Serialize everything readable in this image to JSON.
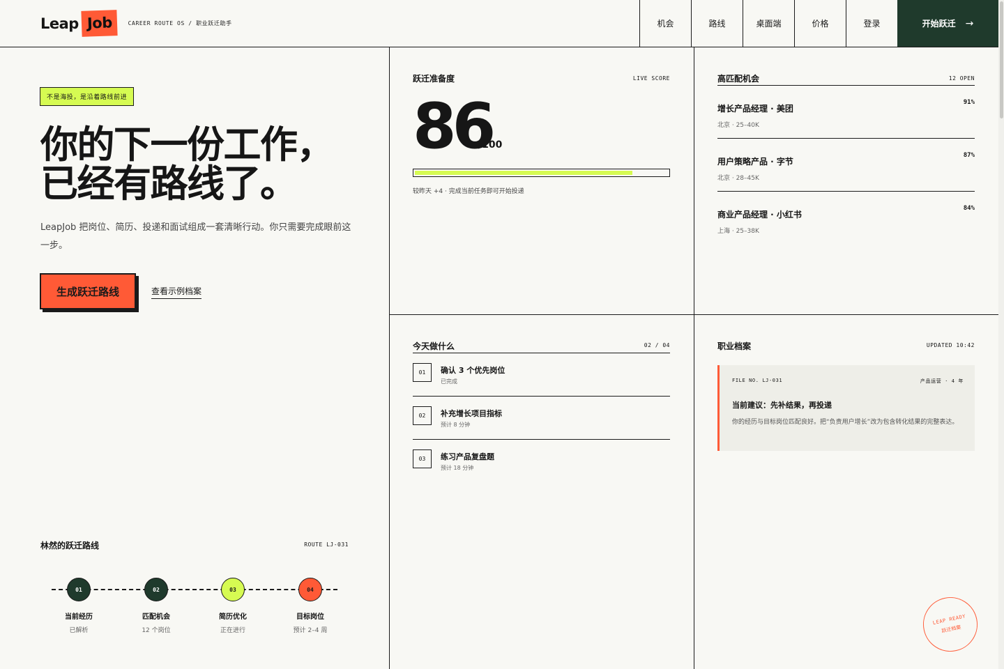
{
  "brand": {
    "logo_part1": "Leap",
    "logo_part2": "Job",
    "tagline": "CAREER ROUTE OS / 职业跃迁助手"
  },
  "nav": {
    "items": [
      "机会",
      "路线",
      "桌面端",
      "价格",
      "登录"
    ],
    "cta_label": "开始跃迁",
    "cta_arrow": "→"
  },
  "hero": {
    "badge": "不是海投，是沿着路线前进",
    "title_line1": "你的下一份工作，",
    "title_line2": "已经有路线了。",
    "description": "LeapJob 把岗位、简历、投递和面试组成一套清晰行动。你只需要完成眼前这一步。",
    "primary_button": "生成跃迁路线",
    "secondary_link": "查看示例档案"
  },
  "route": {
    "title": "林然的跃迁路线",
    "code": "ROUTE LJ-031",
    "steps": [
      {
        "num": "01",
        "name": "当前经历",
        "sub": "已解析"
      },
      {
        "num": "02",
        "name": "匹配机会",
        "sub": "12 个岗位"
      },
      {
        "num": "03",
        "name": "简历优化",
        "sub": "正在进行"
      },
      {
        "num": "04",
        "name": "目标岗位",
        "sub": "预计 2–4 周"
      }
    ]
  },
  "score": {
    "title": "跃迁准备度",
    "meta": "LIVE SCORE",
    "value": "86",
    "max": "/100",
    "progress": 0.86,
    "note": "较昨天 +4 · 完成当前任务即可开始投递"
  },
  "jobs": {
    "title": "高匹配机会",
    "meta": "12 OPEN",
    "items": [
      {
        "title": "增长产品经理 · 美团",
        "sub": "北京 · 25–40K",
        "match": "91%"
      },
      {
        "title": "用户策略产品 · 字节",
        "sub": "北京 · 28–45K",
        "match": "87%"
      },
      {
        "title": "商业产品经理 · 小红书",
        "sub": "上海 · 25–38K",
        "match": "84%"
      }
    ]
  },
  "tasks": {
    "title": "今天做什么",
    "meta": "02 / 04",
    "items": [
      {
        "num": "01",
        "title": "确认 3 个优先岗位",
        "sub": "已完成"
      },
      {
        "num": "02",
        "title": "补充增长项目指标",
        "sub": "预计 8 分钟"
      },
      {
        "num": "03",
        "title": "练习产品复盘题",
        "sub": "预计 18 分钟"
      }
    ]
  },
  "file": {
    "title": "职业档案",
    "meta": "UPDATED 10:42",
    "file_no": "FILE NO. LJ-031",
    "tag": "产品运营 · 4 年",
    "headline": "当前建议：先补结果，再投递",
    "body": "你的经历与目标岗位匹配良好。把“负责用户增长”改为包含转化结果的完整表达。"
  },
  "stamp": {
    "top": "LEAP READY",
    "bottom": "跃迁档案"
  },
  "colors": {
    "accent": "#ff5a36",
    "lime": "#d6fb52",
    "green": "#1f3a2c",
    "bg": "#f8f8f4"
  }
}
